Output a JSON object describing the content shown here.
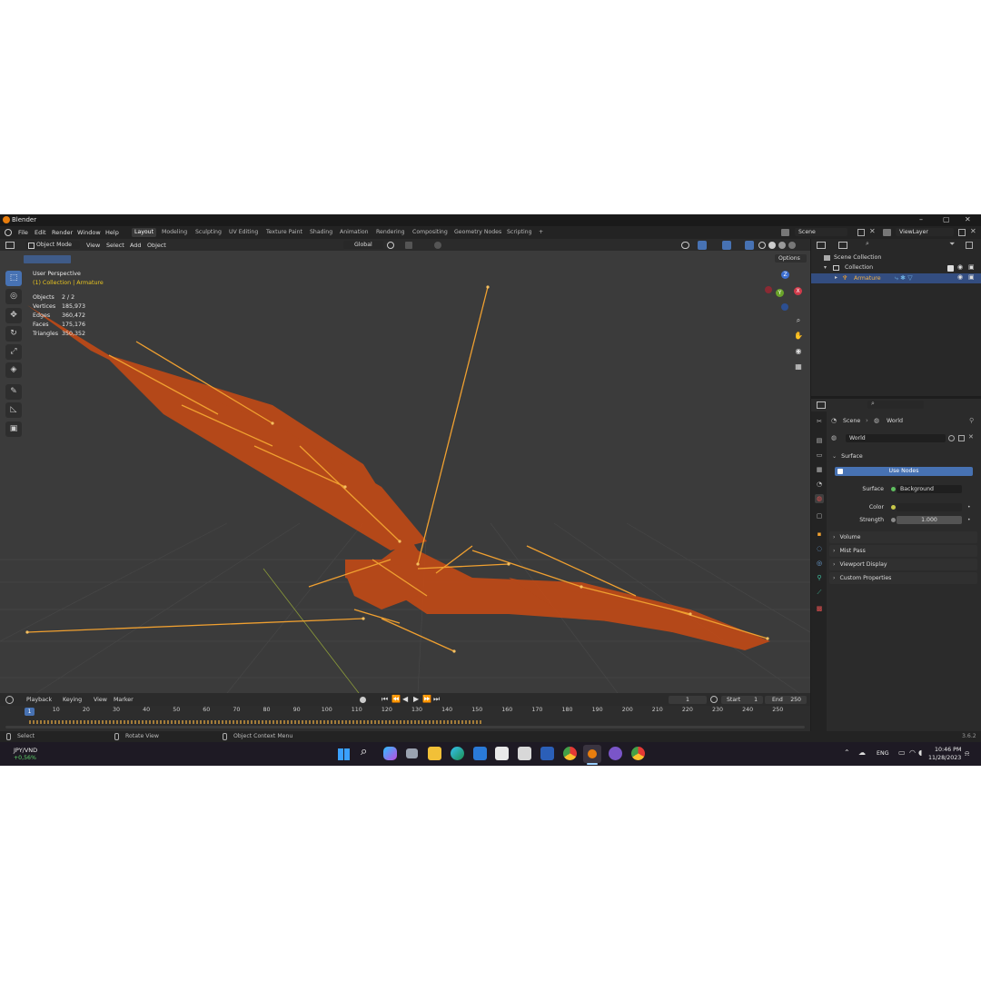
{
  "window": {
    "title": "Blender"
  },
  "menu": [
    "File",
    "Edit",
    "Render",
    "Window",
    "Help"
  ],
  "workspaces": [
    "Layout",
    "Modeling",
    "Sculpting",
    "UV Editing",
    "Texture Paint",
    "Shading",
    "Animation",
    "Rendering",
    "Compositing",
    "Geometry Nodes",
    "Scripting",
    "+"
  ],
  "active_workspace": "Layout",
  "scene_field": "Scene",
  "viewlayer_field": "ViewLayer",
  "viewport_header": {
    "mode": "Object Mode",
    "menus": [
      "View",
      "Select",
      "Add",
      "Object"
    ],
    "orientation": "Global",
    "options_label": "Options"
  },
  "overlay_text": {
    "view_name": "User Perspective",
    "collection_line": "(1) Collection | Armature"
  },
  "stats": [
    {
      "label": "Objects",
      "value": "2 / 2"
    },
    {
      "label": "Vertices",
      "value": "185,973"
    },
    {
      "label": "Edges",
      "value": "360,472"
    },
    {
      "label": "Faces",
      "value": "175,176"
    },
    {
      "label": "Triangles",
      "value": "350,352"
    }
  ],
  "gizmo": {
    "z": "Z",
    "y": "Y",
    "x": "X"
  },
  "outliner": {
    "scene_collection": "Scene Collection",
    "collection": "Collection",
    "armature": "Armature"
  },
  "properties": {
    "breadcrumb_scene": "Scene",
    "breadcrumb_world": "World",
    "world_name": "World",
    "surface_panel": "Surface",
    "use_nodes": "Use Nodes",
    "surface_label": "Surface",
    "surface_value": "Background",
    "color_label": "Color",
    "strength_label": "Strength",
    "strength_value": "1.000",
    "collapsed_panels": [
      "Volume",
      "Mist Pass",
      "Viewport Display",
      "Custom Properties"
    ]
  },
  "timeline": {
    "menus": [
      "Playback",
      "Keying",
      "View",
      "Marker"
    ],
    "current_frame": "1",
    "start_label": "Start",
    "start_value": "1",
    "end_label": "End",
    "end_value": "250",
    "frame_ticks": [
      "10",
      "20",
      "30",
      "40",
      "50",
      "60",
      "70",
      "80",
      "90",
      "100",
      "110",
      "120",
      "130",
      "140",
      "150",
      "160",
      "170",
      "180",
      "190",
      "200",
      "210",
      "220",
      "230",
      "240",
      "250"
    ],
    "playhead": "1"
  },
  "statusbar": {
    "select": "Select",
    "rotate": "Rotate View",
    "context": "Object Context Menu",
    "version": "3.6.2"
  },
  "taskbar": {
    "ticker_name": "JPY/VND",
    "ticker_change": "+0,56%",
    "lang": "ENG",
    "time": "10:46 PM",
    "date": "11/28/2023"
  },
  "colors": {
    "accent": "#4772b3",
    "bones": "#f0a030",
    "mesh": "#d2541c",
    "selected_text": "#e8c420"
  }
}
